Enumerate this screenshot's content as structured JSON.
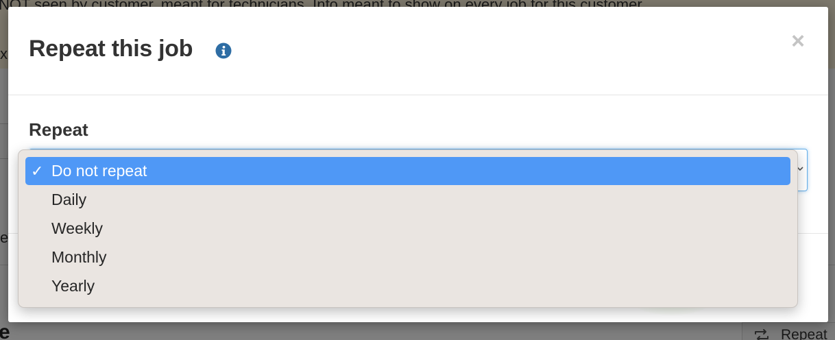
{
  "background": {
    "note_text": "NOT seen by customer, meant for technicians. Info meant to show on every job for this customer.",
    "note_close": "x",
    "left_fragment": "e",
    "left_heading_fragment": "e",
    "repeat_button_label": "Repeat"
  },
  "modal": {
    "title": "Repeat this job",
    "info_icon": "info-circle-icon",
    "close_label": "×",
    "field_label": "Repeat",
    "select": {
      "selected_value": "Do not repeat",
      "options": [
        {
          "label": "Do not repeat",
          "selected": true,
          "check": "✓"
        },
        {
          "label": "Daily",
          "selected": false,
          "check": ""
        },
        {
          "label": "Weekly",
          "selected": false,
          "check": ""
        },
        {
          "label": "Monthly",
          "selected": false,
          "check": ""
        },
        {
          "label": "Yearly",
          "selected": false,
          "check": ""
        }
      ]
    }
  },
  "colors": {
    "overlay": "#7d7d7d",
    "info_icon": "#2e6da4",
    "selected_option": "#4f98f6",
    "dropdown_bg": "#eae5e1",
    "focus_border": "#66afe9"
  }
}
